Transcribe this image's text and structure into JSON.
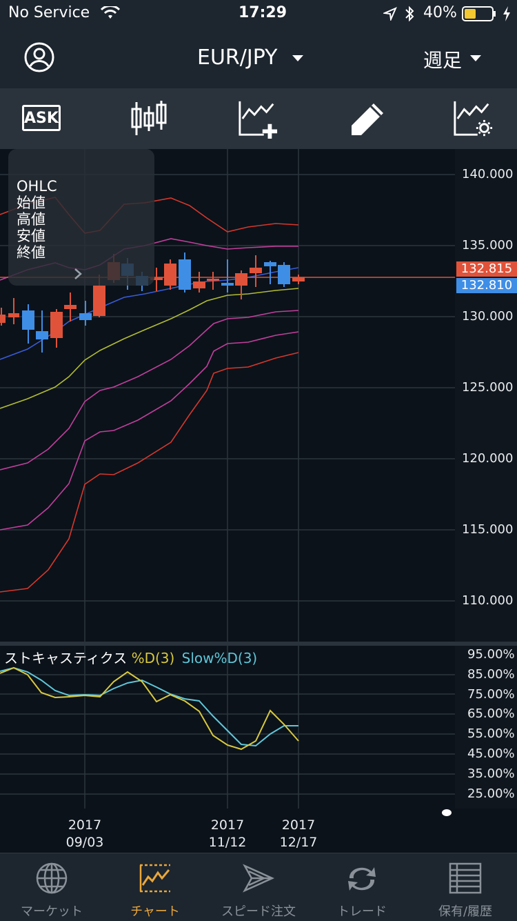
{
  "status": {
    "carrier": "No Service",
    "time": "17:29",
    "battery": "40%"
  },
  "nav": {
    "symbol": "EUR/JPY",
    "timeframe": "週足"
  },
  "toolbar": {
    "ask_label": "ASK"
  },
  "ohlc_panel": {
    "title": "OHLC",
    "open": "始値",
    "high": "高値",
    "low": "安値",
    "close": "終値"
  },
  "price_axis": [
    "140.000",
    "135.000",
    "130.000",
    "125.000",
    "120.000",
    "115.000",
    "110.000"
  ],
  "price_tags": {
    "ask": "132.815",
    "bid": "132.810"
  },
  "stochastic": {
    "name": "ストキャスティクス",
    "d_label": "%D(3)",
    "slow_label": "Slow%D(3)",
    "axis": [
      "95.00%",
      "85.00%",
      "75.00%",
      "65.00%",
      "55.00%",
      "45.00%",
      "35.00%",
      "25.00%"
    ]
  },
  "time_axis": [
    {
      "year": "2017",
      "date": "09/03"
    },
    {
      "year": "2017",
      "date": "11/12"
    },
    {
      "year": "2017",
      "date": "12/17"
    }
  ],
  "tabs": [
    {
      "label": "マーケット",
      "active": false
    },
    {
      "label": "チャート",
      "active": true
    },
    {
      "label": "スピード注文",
      "active": false
    },
    {
      "label": "トレード",
      "active": false
    },
    {
      "label": "保有/履歴",
      "active": false
    }
  ],
  "colors": {
    "up": "#e0533a",
    "down": "#3f8ee6",
    "d_line": "#d9c93e",
    "slow_line": "#5fc7d8",
    "accent": "#e9a73a"
  }
}
